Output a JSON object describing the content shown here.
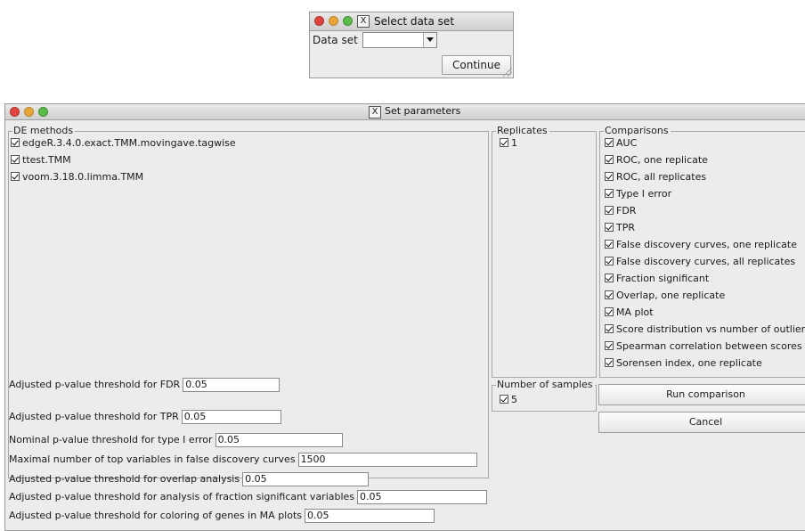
{
  "select_dialog": {
    "title": "Select data set",
    "close_glyph": "X",
    "data_set_label": "Data set",
    "data_set_value": "",
    "continue_label": "Continue"
  },
  "params_dialog": {
    "title": "Set parameters",
    "close_glyph": "X",
    "de_methods": {
      "label": "DE methods",
      "items": [
        {
          "label": "edgeR.3.4.0.exact.TMM.movingave.tagwise",
          "checked": true
        },
        {
          "label": "ttest.TMM",
          "checked": true
        },
        {
          "label": "voom.3.18.0.limma.TMM",
          "checked": true
        }
      ]
    },
    "replicates": {
      "label": "Replicates",
      "items": [
        {
          "label": "1",
          "checked": true
        }
      ]
    },
    "comparisons": {
      "label": "Comparisons",
      "items": [
        {
          "label": "AUC",
          "checked": true
        },
        {
          "label": "ROC, one replicate",
          "checked": true
        },
        {
          "label": "ROC, all replicates",
          "checked": true
        },
        {
          "label": "Type I error",
          "checked": true
        },
        {
          "label": "FDR",
          "checked": true
        },
        {
          "label": "TPR",
          "checked": true
        },
        {
          "label": "False discovery curves, one replicate",
          "checked": true
        },
        {
          "label": "False discovery curves, all replicates",
          "checked": true
        },
        {
          "label": "Fraction significant",
          "checked": true
        },
        {
          "label": "Overlap, one replicate",
          "checked": true
        },
        {
          "label": "MA plot",
          "checked": true
        },
        {
          "label": "Score distribution vs number of outliers",
          "checked": true
        },
        {
          "label": "Spearman correlation between scores",
          "checked": true
        },
        {
          "label": "Sorensen index, one replicate",
          "checked": true
        }
      ]
    },
    "number_of_samples": {
      "label": "Number of samples",
      "items": [
        {
          "label": "5",
          "checked": true
        }
      ]
    },
    "params": [
      {
        "label": "Adjusted p-value threshold for FDR",
        "value": "0.05"
      },
      {
        "label": "Adjusted p-value threshold for TPR",
        "value": "0.05"
      },
      {
        "label": "Nominal p-value threshold for type I error",
        "value": "0.05"
      },
      {
        "label": "Maximal number of top variables in false discovery curves",
        "value": "1500"
      },
      {
        "label": "Adjusted p-value threshold for overlap analysis",
        "value": "0.05"
      },
      {
        "label": "Adjusted p-value threshold for analysis of fraction significant variables",
        "value": "0.05"
      },
      {
        "label": "Adjusted p-value threshold for coloring of genes in MA plots",
        "value": "0.05"
      }
    ],
    "run_label": "Run comparison",
    "cancel_label": "Cancel"
  },
  "colors": {
    "window_bg": "#ececec",
    "close_red": "#e0443e",
    "minimize_yellow": "#e7a637",
    "zoom_green": "#5cbc4a"
  }
}
